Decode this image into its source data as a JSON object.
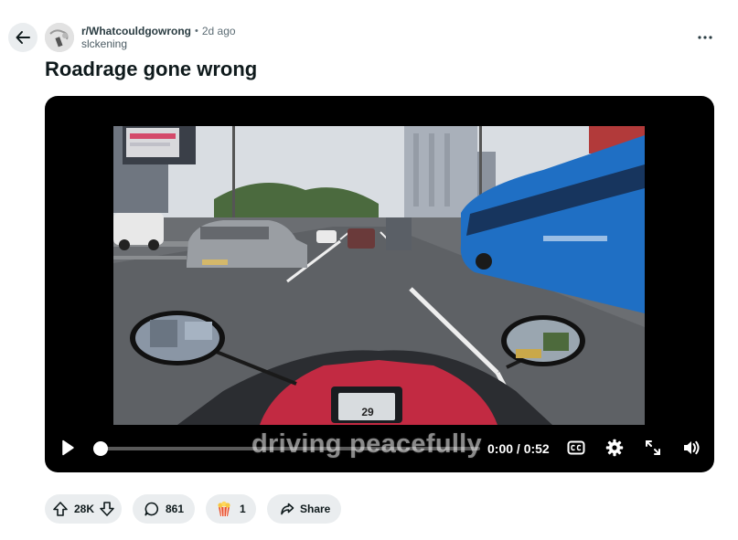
{
  "post": {
    "subreddit": "r/Whatcouldgowrong",
    "separator": "•",
    "age": "2d ago",
    "username": "slckening",
    "title": "Roadrage gone wrong"
  },
  "video": {
    "caption": "driving peacefully",
    "time": "0:00 / 0:52",
    "progress": 0,
    "speedometer": "29"
  },
  "actions": {
    "upvotes": "28K",
    "comments": "861",
    "awards": "1",
    "share_label": "Share"
  },
  "icons": [
    "back-arrow-icon",
    "more-options-icon",
    "play-icon",
    "captions-icon",
    "settings-gear-icon",
    "fullscreen-icon",
    "volume-icon",
    "upvote-icon",
    "downvote-icon",
    "comment-icon",
    "award-icon",
    "share-icon"
  ],
  "colors": {
    "pill_bg": "#eaedef",
    "player_bg": "#000000",
    "bus_blue": "#1f6fc4"
  }
}
